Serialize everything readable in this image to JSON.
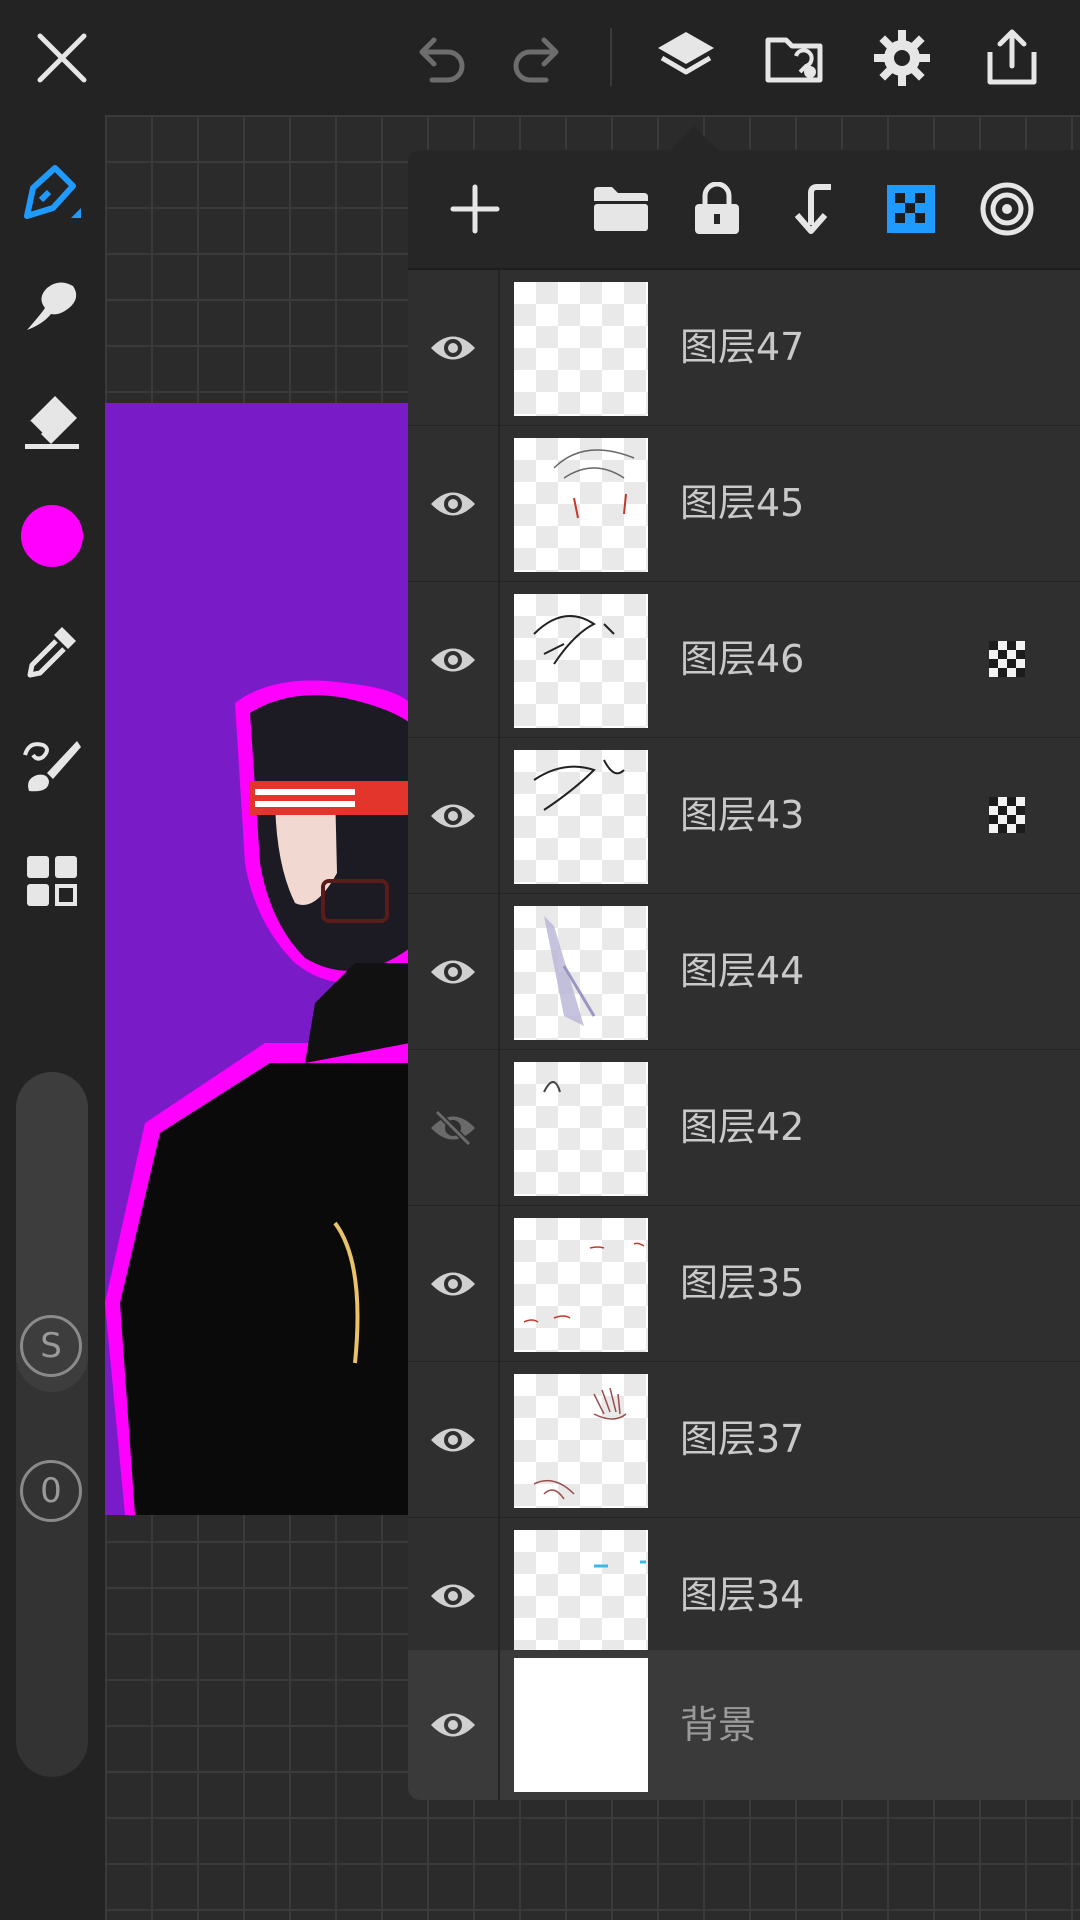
{
  "colors": {
    "accent": "#1f9bff",
    "brush_color": "#ff00ff",
    "canvas_bg": "#7a1bc8"
  },
  "toolbar": {
    "icons": [
      "close-icon",
      "undo-icon",
      "redo-icon",
      "layers-icon",
      "import-icon",
      "settings-icon",
      "share-icon"
    ]
  },
  "tools": {
    "items": [
      "pen-tool",
      "smudge-tool",
      "eraser-tool",
      "color-swatch",
      "eyedropper-tool",
      "brush-settings-tool",
      "gallery-tool"
    ],
    "size_label": "S",
    "opacity_label": "0"
  },
  "layers_panel": {
    "toolbar_icons": [
      "add-layer-icon",
      "folder-icon",
      "lock-icon",
      "merge-down-icon",
      "transparency-lock-icon",
      "blend-icon"
    ],
    "layers": [
      {
        "name": "图层47",
        "visible": true,
        "alpha_locked": false
      },
      {
        "name": "图层45",
        "visible": true,
        "alpha_locked": false
      },
      {
        "name": "图层46",
        "visible": true,
        "alpha_locked": true
      },
      {
        "name": "图层43",
        "visible": true,
        "alpha_locked": true
      },
      {
        "name": "图层44",
        "visible": true,
        "alpha_locked": false
      },
      {
        "name": "图层42",
        "visible": false,
        "alpha_locked": false
      },
      {
        "name": "图层35",
        "visible": true,
        "alpha_locked": false
      },
      {
        "name": "图层37",
        "visible": true,
        "alpha_locked": false
      },
      {
        "name": "图层34",
        "visible": true,
        "alpha_locked": false
      },
      {
        "name": "背景",
        "visible": true,
        "alpha_locked": false,
        "selected": true
      }
    ]
  }
}
